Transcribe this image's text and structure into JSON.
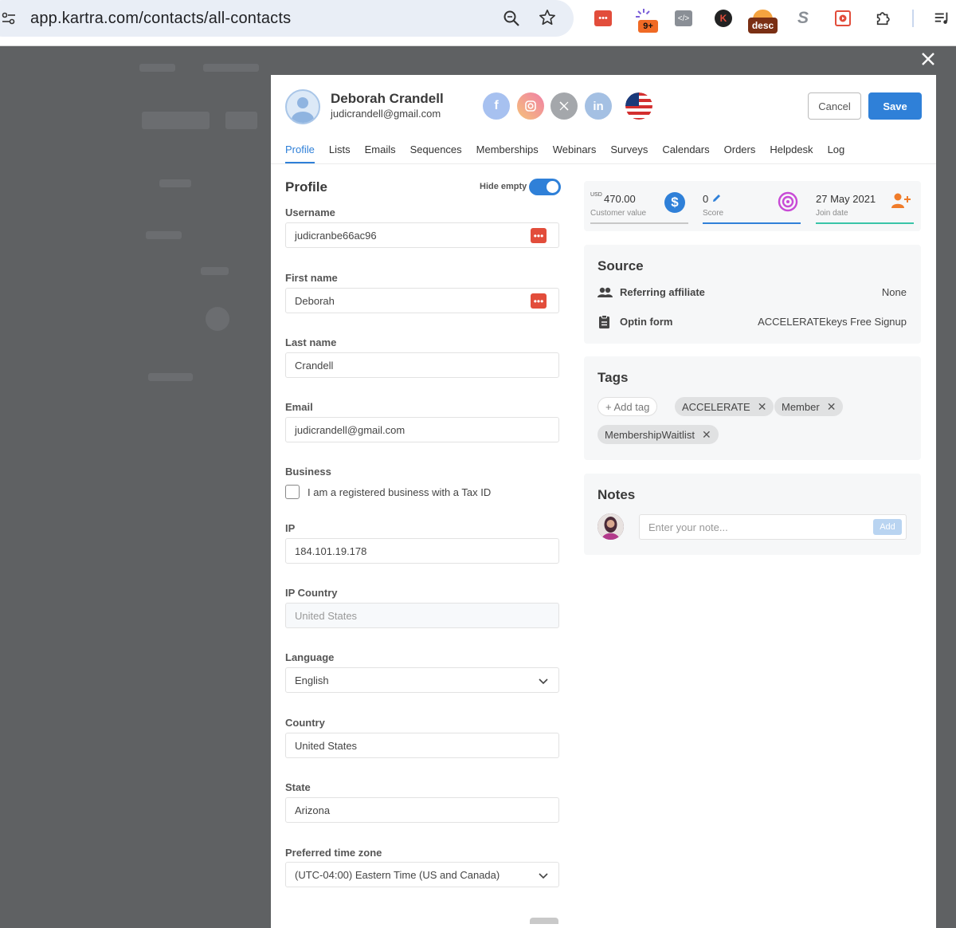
{
  "browser": {
    "url": "app.kartra.com/contacts/all-contacts",
    "extension_badge": "9+",
    "extension_desc": "desc"
  },
  "contact": {
    "name": "Deborah Crandell",
    "email": "judicrandell@gmail.com"
  },
  "header": {
    "cancel_label": "Cancel",
    "save_label": "Save"
  },
  "tabs": [
    "Profile",
    "Lists",
    "Emails",
    "Sequences",
    "Memberships",
    "Webinars",
    "Surveys",
    "Calendars",
    "Orders",
    "Helpdesk",
    "Log"
  ],
  "profile": {
    "title": "Profile",
    "hide_empty_label": "Hide empty",
    "hide_empty_on": true,
    "fields": {
      "username": {
        "label": "Username",
        "value": "judicranbe66ac96"
      },
      "first_name": {
        "label": "First name",
        "value": "Deborah"
      },
      "last_name": {
        "label": "Last name",
        "value": "Crandell"
      },
      "email": {
        "label": "Email",
        "value": "judicrandell@gmail.com"
      },
      "business": {
        "label": "Business",
        "checkbox_label": "I am a registered business with a Tax ID"
      },
      "ip": {
        "label": "IP",
        "value": "184.101.19.178"
      },
      "ip_country": {
        "label": "IP Country",
        "value": "United States"
      },
      "language": {
        "label": "Language",
        "value": "English"
      },
      "country": {
        "label": "Country",
        "value": "United States"
      },
      "state": {
        "label": "State",
        "value": "Arizona"
      },
      "time_zone": {
        "label": "Preferred time zone",
        "value": "(UTC-04:00) Eastern Time (US and Canada)"
      }
    }
  },
  "stats": {
    "currency": "USD",
    "customer_value": "470.00",
    "customer_value_label": "Customer value",
    "score": "0",
    "score_label": "Score",
    "join_date": "27 May 2021",
    "join_date_label": "Join date"
  },
  "source": {
    "title": "Source",
    "referring_affiliate_label": "Referring affiliate",
    "referring_affiliate_value": "None",
    "optin_form_label": "Optin form",
    "optin_form_value": "ACCELERATEkeys Free Signup"
  },
  "tags": {
    "title": "Tags",
    "add_label": "+ Add tag",
    "items": [
      "ACCELERATE",
      "Member",
      "MembershipWaitlist"
    ]
  },
  "notes": {
    "title": "Notes",
    "placeholder": "Enter your note...",
    "add_label": "Add"
  },
  "colors": {
    "accent": "#2f80d8",
    "overlay": "#5f6163",
    "red_icon": "#e24d3b",
    "customer_value_bar": "#c8c8c8",
    "score_bar": "#2f80d8",
    "join_date_bar": "#39c4a8"
  }
}
